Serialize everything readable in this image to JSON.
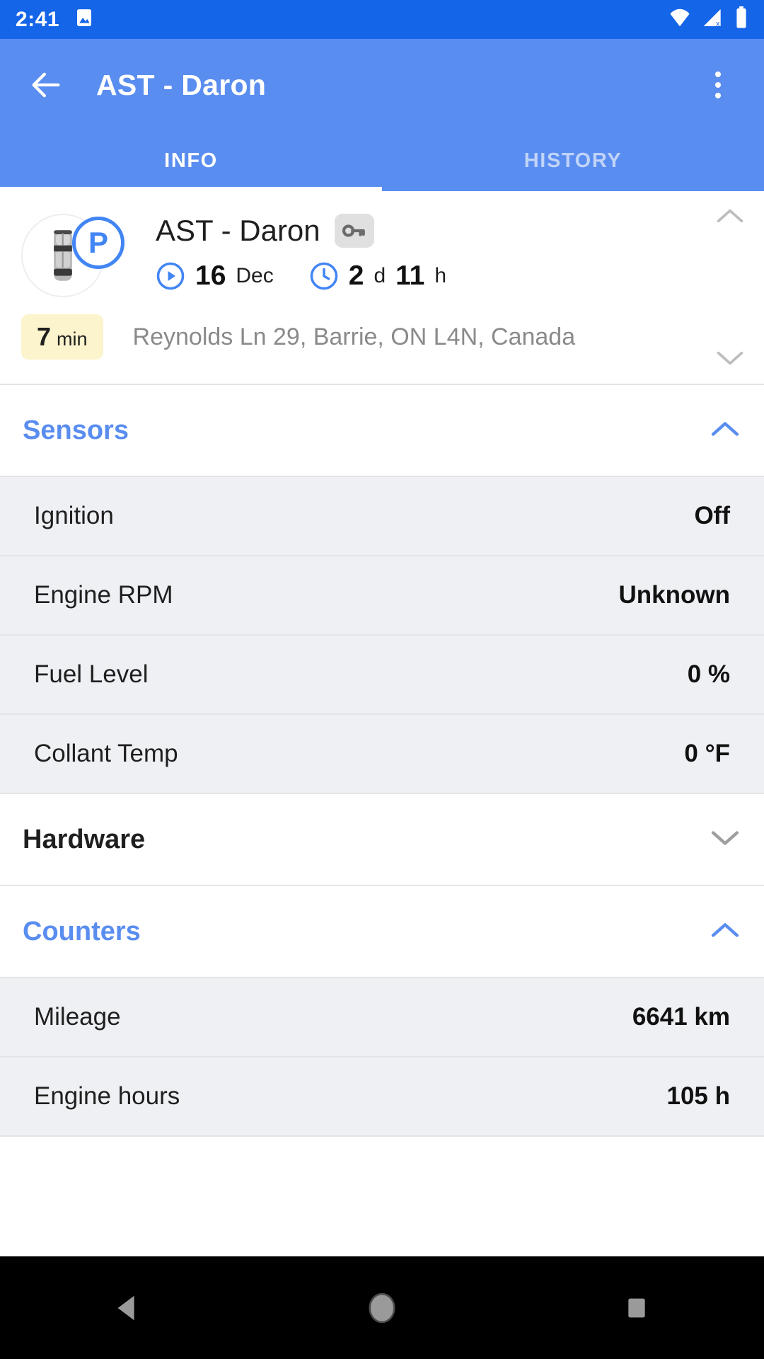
{
  "status_bar": {
    "time": "2:41",
    "icons": [
      "photo-icon",
      "wifi-icon",
      "cellular-off-icon",
      "battery-icon"
    ]
  },
  "app_bar": {
    "title": "AST - Daron",
    "back_icon": "arrow-left-icon",
    "overflow_icon": "more-vertical-icon",
    "accent_color": "#5a8df0"
  },
  "tabs": [
    {
      "label": "INFO",
      "active": true
    },
    {
      "label": "HISTORY",
      "active": false
    }
  ],
  "vehicle_card": {
    "name": "AST - Daron",
    "status_badge": "P",
    "key_icon": "key-icon",
    "vehicle_icon": "car-top-view-icon",
    "date": {
      "icon": "play-circle-icon",
      "value": "16",
      "unit": "Dec"
    },
    "duration": {
      "icon": "clock-icon",
      "days_value": "2",
      "days_unit": "d",
      "hours_value": "11",
      "hours_unit": "h"
    },
    "idle_badge": {
      "value": "7",
      "unit": "min",
      "color": "#fcf4cd"
    },
    "address": "Reynolds Ln 29, Barrie, ON L4N, Canada",
    "collapse_icon_top": "chevron-up-icon",
    "collapse_icon_bottom": "chevron-down-icon"
  },
  "sections": [
    {
      "title": "Sensors",
      "expanded": true,
      "chevron": "chevron-up-icon",
      "color": "#5a8df0",
      "rows": [
        {
          "label": "Ignition",
          "value": "Off"
        },
        {
          "label": "Engine RPM",
          "value": "Unknown"
        },
        {
          "label": "Fuel Level",
          "value": "0 %"
        },
        {
          "label": "Collant Temp",
          "value": "0 °F"
        }
      ]
    },
    {
      "title": "Hardware",
      "expanded": false,
      "chevron": "chevron-down-icon",
      "color": "#1f1f1f",
      "rows": []
    },
    {
      "title": "Counters",
      "expanded": true,
      "chevron": "chevron-up-icon",
      "color": "#5a8df0",
      "rows": [
        {
          "label": "Mileage",
          "value": "6641 km"
        },
        {
          "label": "Engine hours",
          "value": "105 h"
        }
      ]
    }
  ],
  "nav_bar": {
    "back": "triangle-back-icon",
    "home": "circle-home-icon",
    "recents": "square-recents-icon"
  }
}
